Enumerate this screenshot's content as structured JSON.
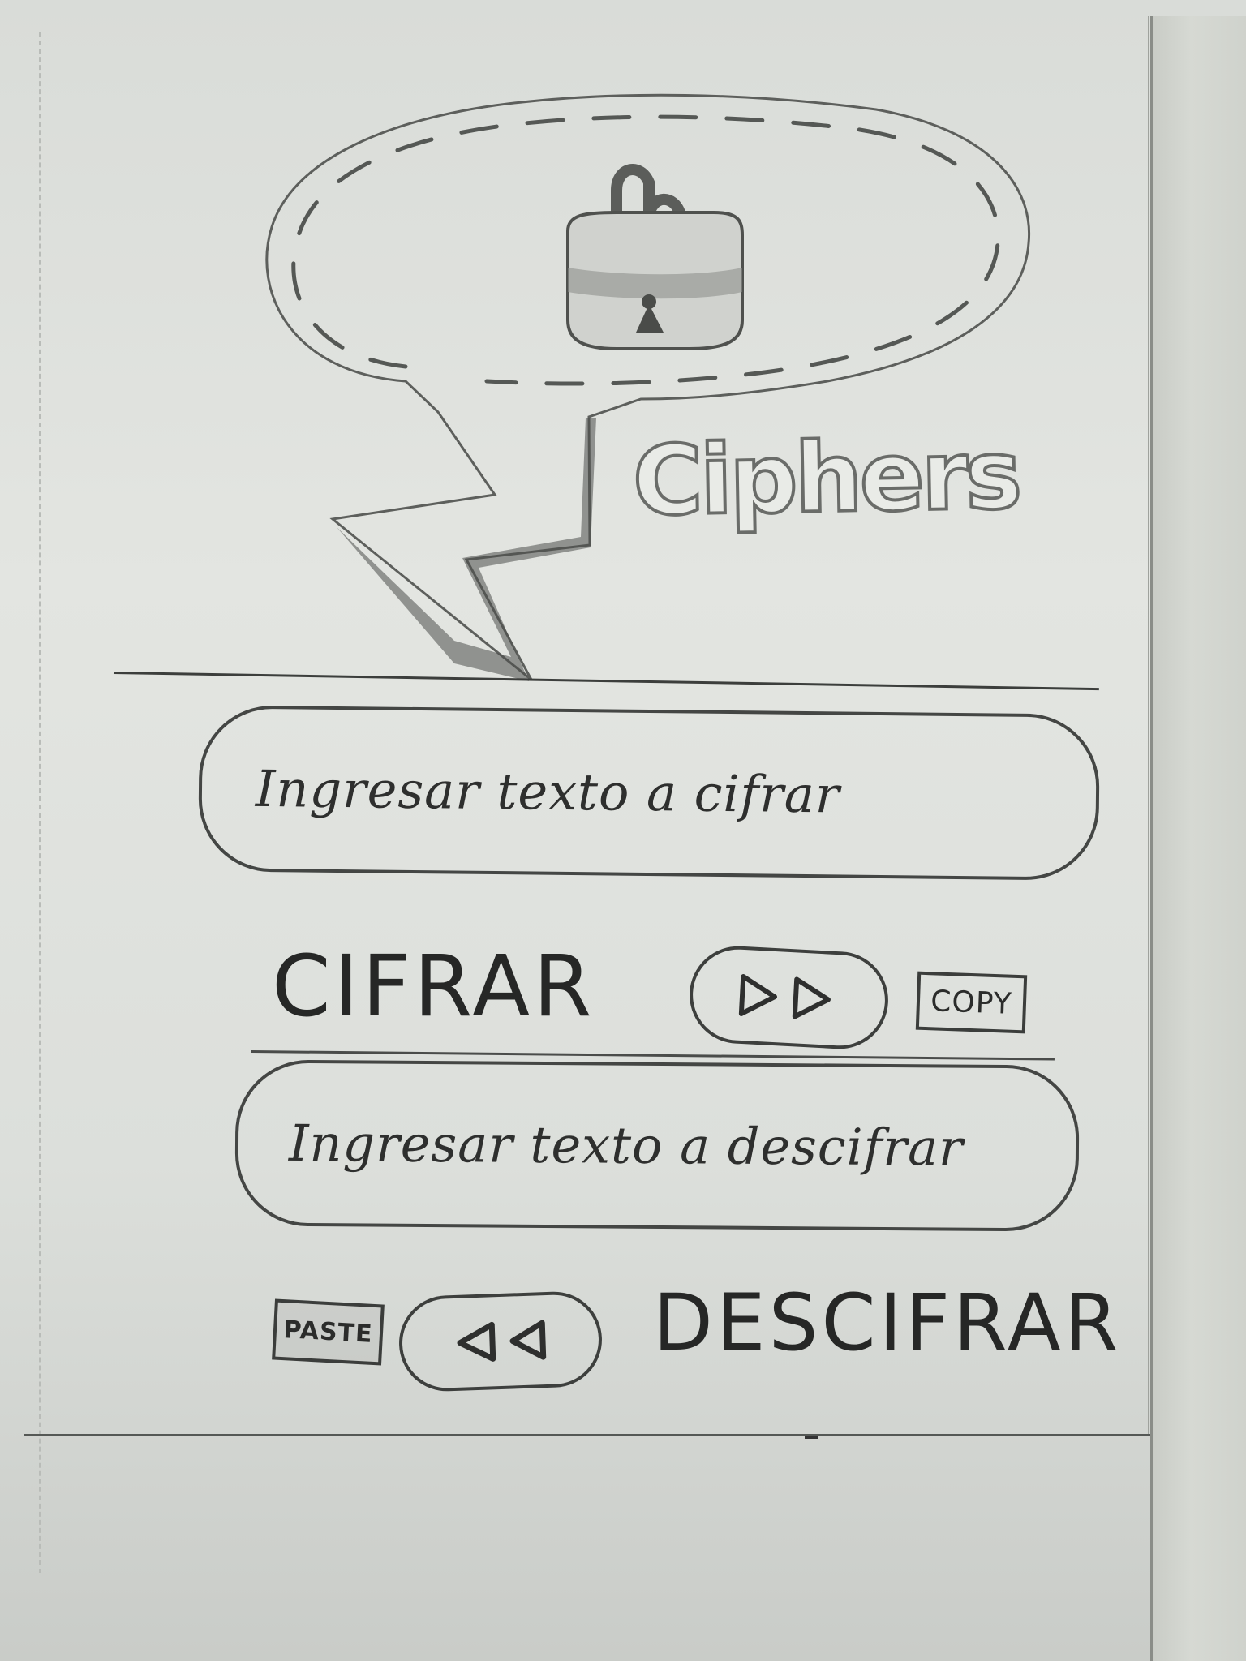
{
  "app": {
    "name": "Ciphers"
  },
  "encrypt": {
    "input_placeholder": "Ingresar texto a cifrar",
    "action_label": "CIFRAR",
    "copy_label": "COPY"
  },
  "decrypt": {
    "input_placeholder": "Ingresar texto a descifrar",
    "action_label": "DESCIFRAR",
    "paste_label": "PASTE"
  },
  "icons": {
    "logo": "padlock-icon",
    "encrypt_button": "double-play-forward-icon",
    "decrypt_button": "double-play-backward-icon"
  },
  "colors": {
    "paper": "#e3e5e1",
    "ink": "#2b2c2b",
    "pencil": "#6a6c69"
  }
}
